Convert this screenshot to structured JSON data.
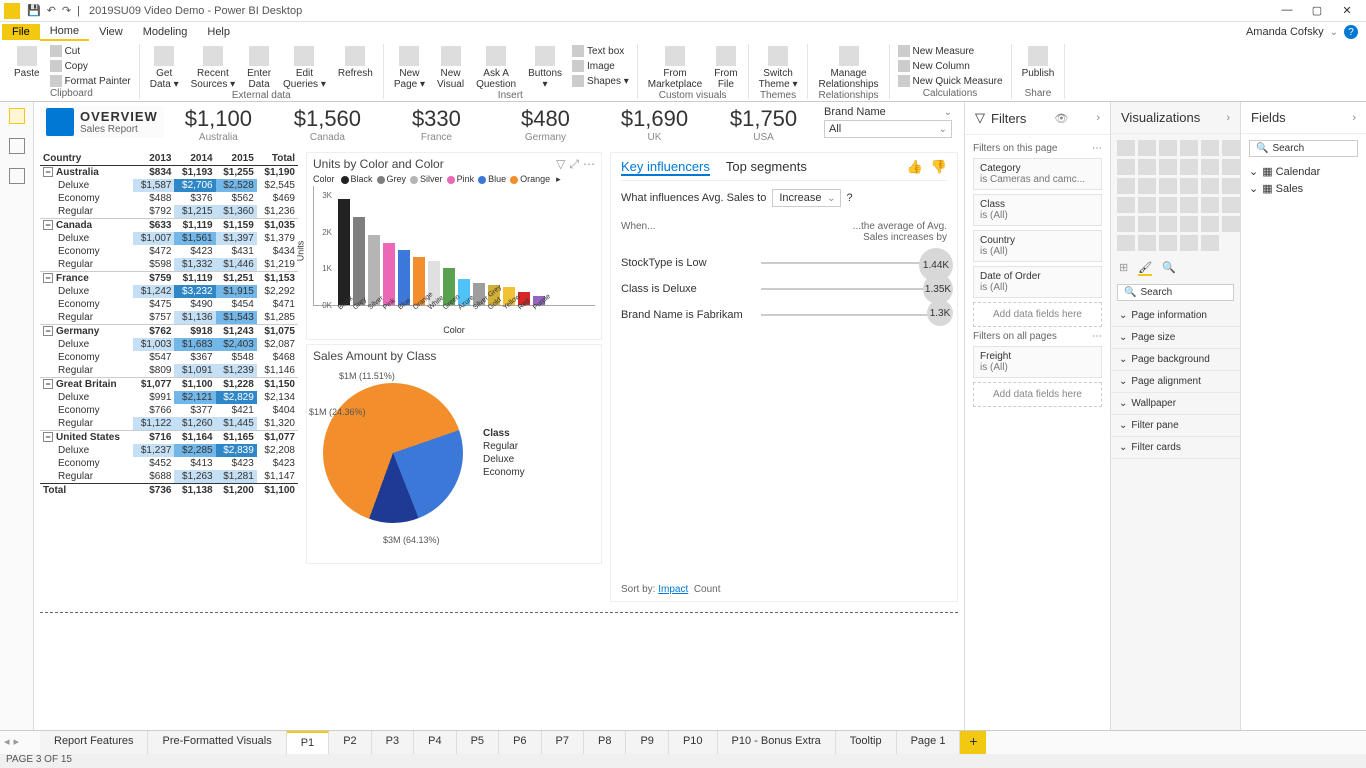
{
  "titlebar": {
    "title": "2019SU09 Video Demo - Power BI Desktop"
  },
  "menu": {
    "file": "File",
    "tabs": [
      "Home",
      "View",
      "Modeling",
      "Help"
    ],
    "activeTab": "Home",
    "user": "Amanda Cofsky"
  },
  "ribbon": {
    "groups": [
      {
        "label": "Clipboard",
        "big": [
          {
            "label": "Paste"
          }
        ],
        "small": [
          "Cut",
          "Copy",
          "Format Painter"
        ]
      },
      {
        "label": "External data",
        "big": [
          {
            "label": "Get\nData ▾"
          },
          {
            "label": "Recent\nSources ▾"
          },
          {
            "label": "Enter\nData"
          },
          {
            "label": "Edit\nQueries ▾"
          },
          {
            "label": "Refresh"
          }
        ]
      },
      {
        "label": "Insert",
        "big": [
          {
            "label": "New\nPage ▾"
          },
          {
            "label": "New\nVisual"
          },
          {
            "label": "Ask A\nQuestion"
          },
          {
            "label": "Buttons\n▾"
          }
        ],
        "small": [
          "Text box",
          "Image",
          "Shapes ▾"
        ]
      },
      {
        "label": "Custom visuals",
        "big": [
          {
            "label": "From\nMarketplace"
          },
          {
            "label": "From\nFile"
          }
        ]
      },
      {
        "label": "Themes",
        "big": [
          {
            "label": "Switch\nTheme ▾"
          }
        ]
      },
      {
        "label": "Relationships",
        "big": [
          {
            "label": "Manage\nRelationships"
          }
        ]
      },
      {
        "label": "Calculations",
        "small2": [
          "New Measure",
          "New Column",
          "New Quick Measure"
        ]
      },
      {
        "label": "Share",
        "big": [
          {
            "label": "Publish"
          }
        ]
      }
    ]
  },
  "overview": {
    "title": "OVERVIEW",
    "subtitle": "Sales Report"
  },
  "kpis": [
    {
      "value": "$1,100",
      "country": "Australia"
    },
    {
      "value": "$1,560",
      "country": "Canada"
    },
    {
      "value": "$330",
      "country": "France"
    },
    {
      "value": "$480",
      "country": "Germany"
    },
    {
      "value": "$1,690",
      "country": "UK"
    },
    {
      "value": "$1,750",
      "country": "USA"
    }
  ],
  "brandSlicer": {
    "label": "Brand Name",
    "value": "All"
  },
  "matrix": {
    "headers": [
      "Country",
      "2013",
      "2014",
      "2015",
      "Total"
    ],
    "groups": [
      {
        "name": "Australia",
        "vals": [
          "$834",
          "$1,193",
          "$1,255",
          "$1,190"
        ],
        "rows": [
          {
            "n": "Deluxe",
            "v": [
              "$1,587",
              "$2,706",
              "$2,528",
              "$2,545"
            ],
            "hl": [
              1,
              3,
              2,
              0
            ]
          },
          {
            "n": "Economy",
            "v": [
              "$488",
              "$376",
              "$562",
              "$469"
            ]
          },
          {
            "n": "Regular",
            "v": [
              "$792",
              "$1,215",
              "$1,360",
              "$1,236"
            ],
            "hl": [
              0,
              1,
              1,
              0
            ]
          }
        ]
      },
      {
        "name": "Canada",
        "vals": [
          "$633",
          "$1,119",
          "$1,159",
          "$1,035"
        ],
        "rows": [
          {
            "n": "Deluxe",
            "v": [
              "$1,007",
              "$1,561",
              "$1,397",
              "$1,379"
            ],
            "hl": [
              1,
              2,
              1,
              0
            ]
          },
          {
            "n": "Economy",
            "v": [
              "$472",
              "$423",
              "$431",
              "$434"
            ]
          },
          {
            "n": "Regular",
            "v": [
              "$598",
              "$1,332",
              "$1,446",
              "$1,219"
            ],
            "hl": [
              0,
              1,
              1,
              0
            ]
          }
        ]
      },
      {
        "name": "France",
        "vals": [
          "$759",
          "$1,119",
          "$1,251",
          "$1,153"
        ],
        "rows": [
          {
            "n": "Deluxe",
            "v": [
              "$1,242",
              "$3,232",
              "$1,915",
              "$2,292"
            ],
            "hl": [
              1,
              3,
              2,
              0
            ]
          },
          {
            "n": "Economy",
            "v": [
              "$475",
              "$490",
              "$454",
              "$471"
            ]
          },
          {
            "n": "Regular",
            "v": [
              "$757",
              "$1,136",
              "$1,543",
              "$1,285"
            ],
            "hl": [
              0,
              1,
              2,
              0
            ]
          }
        ]
      },
      {
        "name": "Germany",
        "vals": [
          "$762",
          "$918",
          "$1,243",
          "$1,075"
        ],
        "rows": [
          {
            "n": "Deluxe",
            "v": [
              "$1,003",
              "$1,683",
              "$2,403",
              "$2,087"
            ],
            "hl": [
              1,
              2,
              2,
              0
            ]
          },
          {
            "n": "Economy",
            "v": [
              "$547",
              "$367",
              "$548",
              "$468"
            ]
          },
          {
            "n": "Regular",
            "v": [
              "$809",
              "$1,091",
              "$1,239",
              "$1,146"
            ],
            "hl": [
              0,
              1,
              1,
              0
            ]
          }
        ]
      },
      {
        "name": "Great Britain",
        "vals": [
          "$1,077",
          "$1,100",
          "$1,228",
          "$1,150"
        ],
        "rows": [
          {
            "n": "Deluxe",
            "v": [
              "$991",
              "$2,121",
              "$2,829",
              "$2,134"
            ],
            "hl": [
              0,
              2,
              3,
              0
            ]
          },
          {
            "n": "Economy",
            "v": [
              "$766",
              "$377",
              "$421",
              "$404"
            ]
          },
          {
            "n": "Regular",
            "v": [
              "$1,122",
              "$1,260",
              "$1,445",
              "$1,320"
            ],
            "hl": [
              1,
              1,
              1,
              0
            ]
          }
        ]
      },
      {
        "name": "United States",
        "vals": [
          "$716",
          "$1,164",
          "$1,165",
          "$1,077"
        ],
        "rows": [
          {
            "n": "Deluxe",
            "v": [
              "$1,237",
              "$2,285",
              "$2,839",
              "$2,208"
            ],
            "hl": [
              1,
              2,
              3,
              0
            ]
          },
          {
            "n": "Economy",
            "v": [
              "$452",
              "$413",
              "$423",
              "$423"
            ]
          },
          {
            "n": "Regular",
            "v": [
              "$688",
              "$1,263",
              "$1,281",
              "$1,147"
            ],
            "hl": [
              0,
              1,
              1,
              0
            ]
          }
        ]
      }
    ],
    "total": [
      "Total",
      "$736",
      "$1,138",
      "$1,200",
      "$1,100"
    ]
  },
  "chart_data": [
    {
      "type": "bar",
      "title": "Units by Color and Color",
      "xlabel": "Color",
      "ylabel": "Units",
      "ylim": [
        0,
        3000
      ],
      "yticks": [
        "0K",
        "1K",
        "2K",
        "3K"
      ],
      "categories": [
        "Black",
        "Grey",
        "Silver",
        "Pink",
        "Blue",
        "Orange",
        "White",
        "Green",
        "Azure",
        "Silver Grey",
        "Gold",
        "Yellow",
        "Red",
        "Purple"
      ],
      "colors": [
        "#222222",
        "#7f7f7f",
        "#b5b5b5",
        "#ea68b5",
        "#3c78d8",
        "#f28e2b",
        "#e0e0e0",
        "#59a14f",
        "#4fc3f7",
        "#9e9e9e",
        "#d4af37",
        "#f1c232",
        "#d62728",
        "#9467bd"
      ],
      "values": [
        2900,
        2400,
        1900,
        1700,
        1500,
        1300,
        1200,
        1000,
        700,
        600,
        550,
        500,
        350,
        250
      ],
      "legend": [
        "Black",
        "Grey",
        "Silver",
        "Pink",
        "Blue",
        "Orange"
      ]
    },
    {
      "type": "pie",
      "title": "Sales Amount by Class",
      "series_label": "Class",
      "series": [
        {
          "name": "Regular",
          "value": 3000000,
          "pct": 64.13,
          "label": "$3M (64.13%)",
          "color": "#f28e2b"
        },
        {
          "name": "Deluxe",
          "value": 1000000,
          "pct": 24.36,
          "label": "$1M (24.36%)",
          "color": "#3c78d8"
        },
        {
          "name": "Economy",
          "value": 1000000,
          "pct": 11.51,
          "label": "$1M (11.51%)",
          "color": "#1f3a93"
        }
      ]
    }
  ],
  "ki": {
    "tabs": [
      "Key influencers",
      "Top segments"
    ],
    "question_prefix": "What influences Avg. Sales to",
    "question_value": "Increase",
    "col_when": "When...",
    "col_then": "...the average of Avg. Sales increases by",
    "rows": [
      {
        "txt": "StockType is Low",
        "val": "1.44K",
        "size": 34
      },
      {
        "txt": "Class is Deluxe",
        "val": "1.35K",
        "size": 30
      },
      {
        "txt": "Brand Name is Fabrikam",
        "val": "1.3K",
        "size": 26
      }
    ],
    "sort_label": "Sort by:",
    "sort_options": [
      "Impact",
      "Count"
    ]
  },
  "filters": {
    "title": "Filters",
    "onPage": "Filters on this page",
    "onAll": "Filters on all pages",
    "addFields": "Add data fields here",
    "pageFilters": [
      {
        "n": "Category",
        "v": "is Cameras and camc..."
      },
      {
        "n": "Class",
        "v": "is (All)"
      },
      {
        "n": "Country",
        "v": "is (All)"
      },
      {
        "n": "Date of Order",
        "v": "is (All)"
      }
    ],
    "allFilters": [
      {
        "n": "Freight",
        "v": "is (All)"
      }
    ]
  },
  "viz": {
    "title": "Visualizations",
    "searchPlaceholder": "Search",
    "sections": [
      "Page information",
      "Page size",
      "Page background",
      "Page alignment",
      "Wallpaper ",
      " Filter pane",
      "Filter cards"
    ]
  },
  "fields": {
    "title": "Fields",
    "searchPlaceholder": "Search",
    "tables": [
      "Calendar",
      "Sales"
    ]
  },
  "pageTabs": [
    "Report Features",
    "Pre-Formatted Visuals",
    "P1",
    "P2",
    "P3",
    "P4",
    "P5",
    "P6",
    "P7",
    "P8",
    "P9",
    "P10",
    "P10 - Bonus Extra",
    "Tooltip",
    "Page 1"
  ],
  "activePageTab": "P1",
  "status": "PAGE 3 OF 15"
}
